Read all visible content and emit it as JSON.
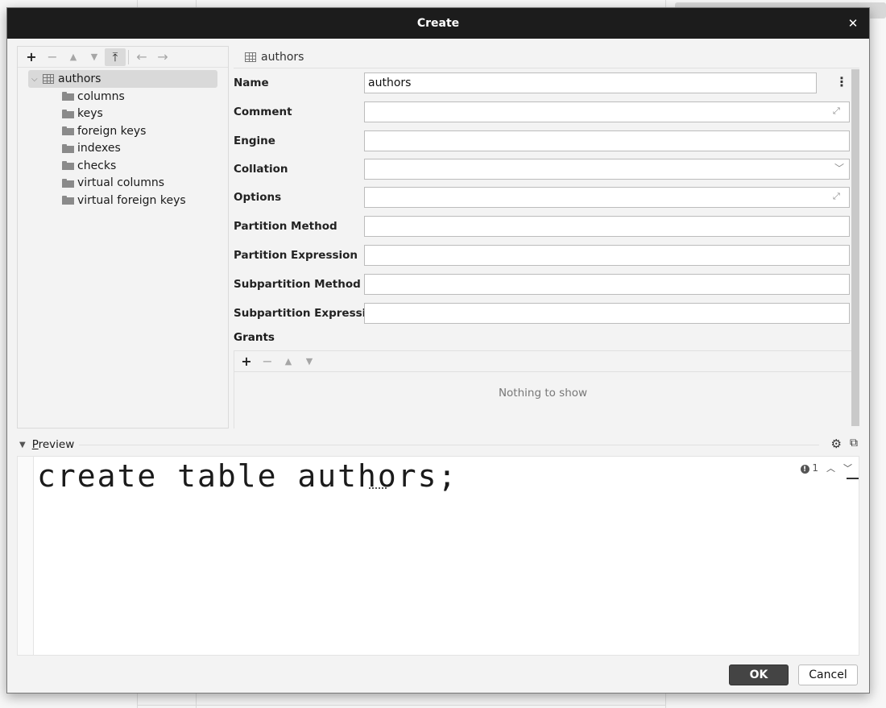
{
  "dialog": {
    "title": "Create",
    "close_icon": "close-icon"
  },
  "tree_toolbar": {
    "buttons": [
      {
        "name": "add",
        "icon": "+",
        "enabled": true
      },
      {
        "name": "remove",
        "icon": "−",
        "enabled": false
      },
      {
        "name": "move-up",
        "icon": "▲",
        "enabled": false
      },
      {
        "name": "move-down",
        "icon": "▼",
        "enabled": false
      },
      {
        "name": "pin-top",
        "icon": "⤒",
        "enabled": true,
        "active": true
      },
      {
        "name": "back",
        "icon": "←",
        "enabled": false
      },
      {
        "name": "forward",
        "icon": "→",
        "enabled": false
      }
    ]
  },
  "tree": {
    "root": {
      "label": "authors",
      "icon": "table-icon",
      "expanded": true
    },
    "children": [
      {
        "label": "columns"
      },
      {
        "label": "keys"
      },
      {
        "label": "foreign keys"
      },
      {
        "label": "indexes"
      },
      {
        "label": "checks"
      },
      {
        "label": "virtual columns"
      },
      {
        "label": "virtual foreign keys"
      }
    ]
  },
  "properties": {
    "header": "authors",
    "fields": [
      {
        "label": "Name",
        "value": "authors",
        "kind": "text-more"
      },
      {
        "label": "Comment",
        "value": "",
        "kind": "expandable"
      },
      {
        "label": "Engine",
        "value": "",
        "kind": "text"
      },
      {
        "label": "Collation",
        "value": "",
        "kind": "dropdown"
      },
      {
        "label": "Options",
        "value": "",
        "kind": "expandable"
      },
      {
        "label": "Partition Method",
        "value": "",
        "kind": "text"
      },
      {
        "label": "Partition Expression",
        "value": "",
        "kind": "text"
      },
      {
        "label": "Subpartition Method",
        "value": "",
        "kind": "text"
      },
      {
        "label": "Subpartition Expression",
        "value": "",
        "kind": "text"
      }
    ],
    "grants": {
      "label": "Grants",
      "toolbar": [
        "+",
        "−",
        "▲",
        "▼"
      ],
      "empty_text": "Nothing to show"
    }
  },
  "preview": {
    "label_mnemonic": "P",
    "label_rest": "review",
    "code": "create table authors;",
    "inspection_count": "1"
  },
  "buttons": {
    "ok": "OK",
    "cancel": "Cancel"
  }
}
